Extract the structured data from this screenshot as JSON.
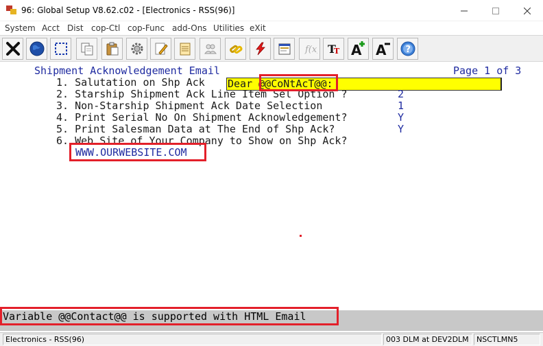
{
  "window": {
    "title": "96: Global Setup V8.62.c02 - [Electronics - RSS(96)]",
    "minimize_glyph": "—",
    "maximize_glyph": "☐",
    "close_glyph": "✕"
  },
  "menu": [
    {
      "label": "System"
    },
    {
      "label": "Acct"
    },
    {
      "label": "Dist"
    },
    {
      "label": "cop-Ctl"
    },
    {
      "label": "cop-Func"
    },
    {
      "label": "add-Ons"
    },
    {
      "label": "Utilities"
    },
    {
      "label": "eXit"
    }
  ],
  "toolbar": [
    {
      "icon": "exit-x-icon"
    },
    {
      "icon": "globe-icon"
    },
    {
      "icon": "select-box-icon"
    },
    {
      "icon": "copy-icon"
    },
    {
      "icon": "paste-icon"
    },
    {
      "icon": "settings-gear-icon"
    },
    {
      "icon": "edit-pencil-icon"
    },
    {
      "icon": "notepad-icon"
    },
    {
      "icon": "users-icon"
    },
    {
      "icon": "chain-link-icon"
    },
    {
      "icon": "lightning-icon"
    },
    {
      "icon": "form-icon"
    },
    {
      "icon": "function-icon"
    },
    {
      "icon": "font-tt-icon"
    },
    {
      "icon": "font-increase-icon"
    },
    {
      "icon": "font-decrease-icon"
    },
    {
      "icon": "help-icon"
    }
  ],
  "screen": {
    "heading": "Shipment Acknowledgement Email",
    "page_info": "Page 1 of 3",
    "rows": [
      {
        "label": " 1. Salutation on Shp Ack",
        "value": ""
      },
      {
        "label": " 2. Starship Shipment Ack Line Item Sel Option ?",
        "value": "2"
      },
      {
        "label": " 3. Non-Starship Shipment Ack Date Selection",
        "value": "1"
      },
      {
        "label": " 4. Print Serial No On Shipment Acknowledgement?",
        "value": "Y"
      },
      {
        "label": " 5. Print Salesman Data at The End of Shp Ack?",
        "value": "Y"
      },
      {
        "label": " 6. Web Site of Your Company to Show on Shp Ack?",
        "value": ""
      }
    ],
    "salutation_value": "Dear @@CoNtAcT@@:",
    "website_value": "WWW.OURWEBSITE.COM",
    "help_text": "Variable @@Contact@@ is supported with HTML Email"
  },
  "status": {
    "company": "Electronics - RSS(96)",
    "session": "003 DLM at DEV2DLM",
    "terminal": "NSCTLMN5"
  },
  "colors": {
    "highlight_red": "#e3202a",
    "input_yellow": "#ffff00",
    "text_blue": "#1e2aa0"
  }
}
